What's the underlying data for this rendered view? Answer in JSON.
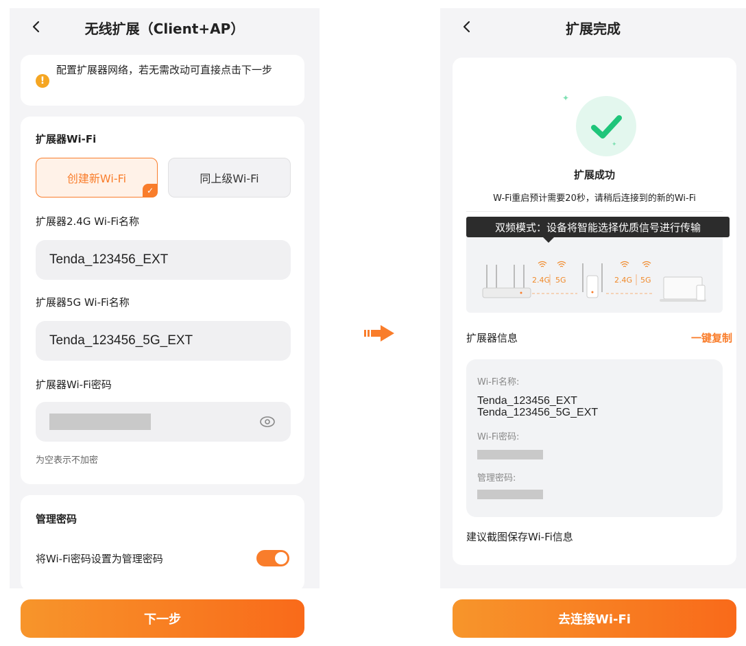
{
  "colors": {
    "accent": "#f97d2b",
    "success": "#1fc57a",
    "page_bg": "#f4f4f6"
  },
  "left": {
    "title": "无线扩展（Client+AP）",
    "notice": "配置扩展器网络，若无需改动可直接点击下一步",
    "wifi_section": {
      "title": "扩展器Wi-Fi",
      "modes": [
        "创建新Wi-Fi",
        "同上级Wi-Fi"
      ],
      "selected_mode": "创建新Wi-Fi"
    },
    "ssid_24g": {
      "label": "扩展器2.4G Wi-Fi名称",
      "value": "Tenda_123456_EXT"
    },
    "ssid_5g": {
      "label": "扩展器5G Wi-Fi名称",
      "value": "Tenda_123456_5G_EXT"
    },
    "password": {
      "label": "扩展器Wi-Fi密码",
      "hint": "为空表示不加密"
    },
    "admin_section": {
      "title": "管理密码",
      "toggle_label": "将Wi-Fi密码设置为管理密码",
      "toggle_on": true
    },
    "next_button": "下一步"
  },
  "right": {
    "title": "扩展完成",
    "success_title": "扩展成功",
    "success_sub": "W-Fi重启预计需要20秒，请稍后连接到的新的Wi-Fi",
    "dual_band": "双频模式：设备将智能选择优质信号进行传输",
    "bands": [
      "2.4G",
      "5G",
      "2.4G",
      "5G"
    ],
    "info_header": "扩展器信息",
    "copy": "一键复制",
    "wifi_name_key": "Wi-Fi名称:",
    "wifi_names": [
      "Tenda_123456_EXT",
      "Tenda_123456_5G_EXT"
    ],
    "wifi_pwd_key": "Wi-Fi密码:",
    "admin_pwd_key": "管理密码:",
    "tip": "建议截图保存Wi-Fi信息",
    "connect_button": "去连接Wi-Fi"
  }
}
